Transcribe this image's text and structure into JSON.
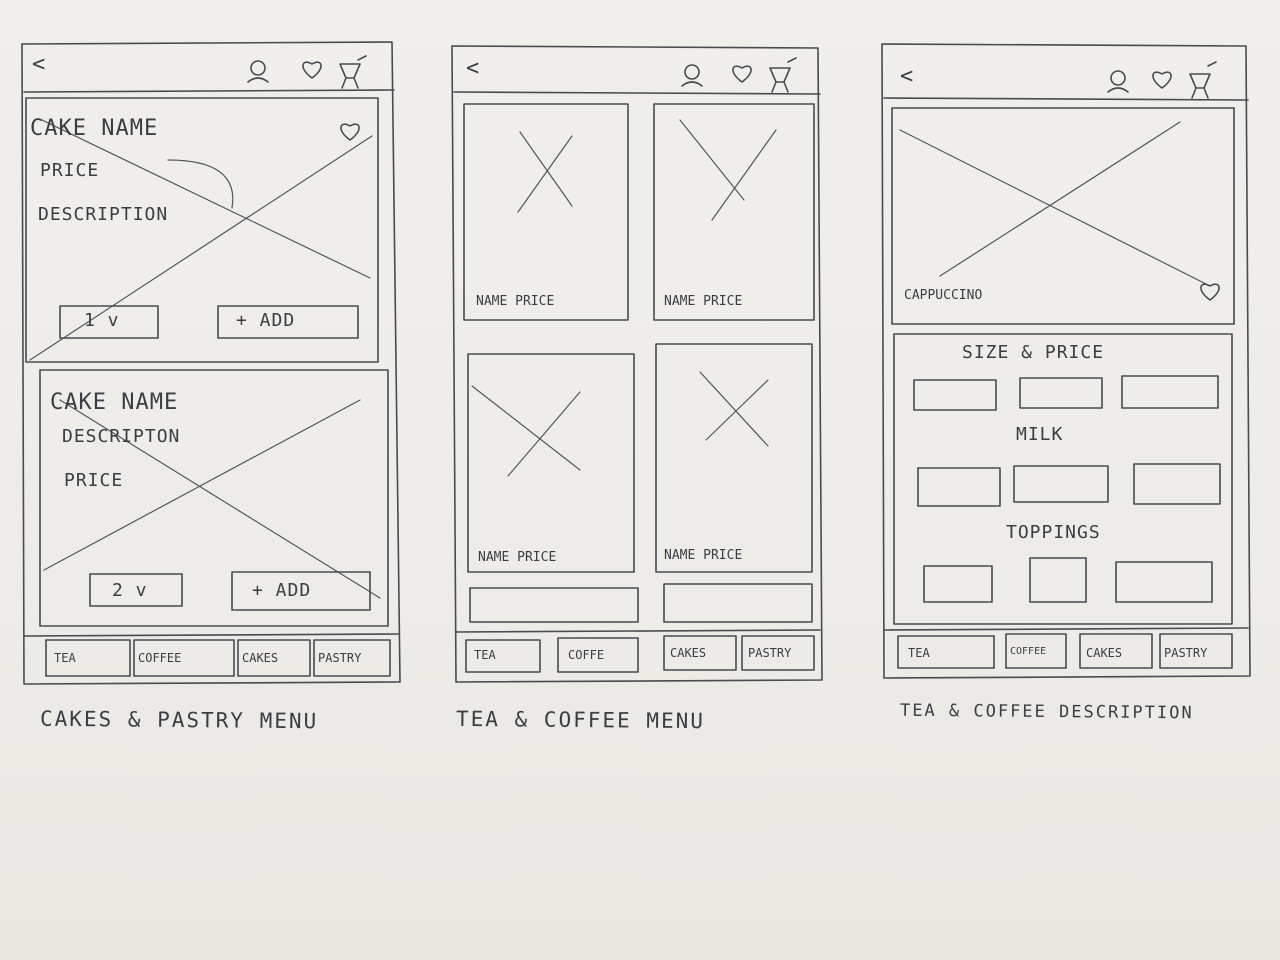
{
  "screens": {
    "cakes": {
      "back": "<",
      "card1": {
        "name": "CAKE NAME",
        "price": "PRICE",
        "description": "DESCRIPTION",
        "qty": "1 v",
        "add": "+ ADD"
      },
      "card2": {
        "name": "CAKE NAME",
        "description": "DESCRIPTON",
        "price": "PRICE",
        "qty": "2 v",
        "add": "+ ADD"
      },
      "tabs": [
        "TEA",
        "COFFEE",
        "CAKES",
        "PASTRY"
      ],
      "caption": "CAKES & PASTRY MENU"
    },
    "menu": {
      "back": "<",
      "items": [
        "NAME PRICE",
        "NAME PRICE",
        "NAME PRICE",
        "NAME PRICE"
      ],
      "tabs": [
        "TEA",
        "COFFE",
        "CAKES",
        "PASTRY"
      ],
      "caption": "TEA & COFFEE MENU"
    },
    "desc": {
      "back": "<",
      "product": "CAPPUCCINO",
      "size_heading": "SIZE & PRICE",
      "milk_heading": "MILK",
      "toppings_heading": "TOPPINGS",
      "tabs": [
        "TEA",
        "COFFEE",
        "CAKES",
        "PASTRY"
      ],
      "caption": "TEA & COFFEE DESCRIPTION"
    }
  },
  "icons": [
    "back-arrow-icon",
    "user-icon",
    "heart-icon",
    "cart-icon",
    "image-placeholder-icon"
  ],
  "colors": {
    "paper": "#eeece8",
    "ink": "#4a4a50"
  }
}
